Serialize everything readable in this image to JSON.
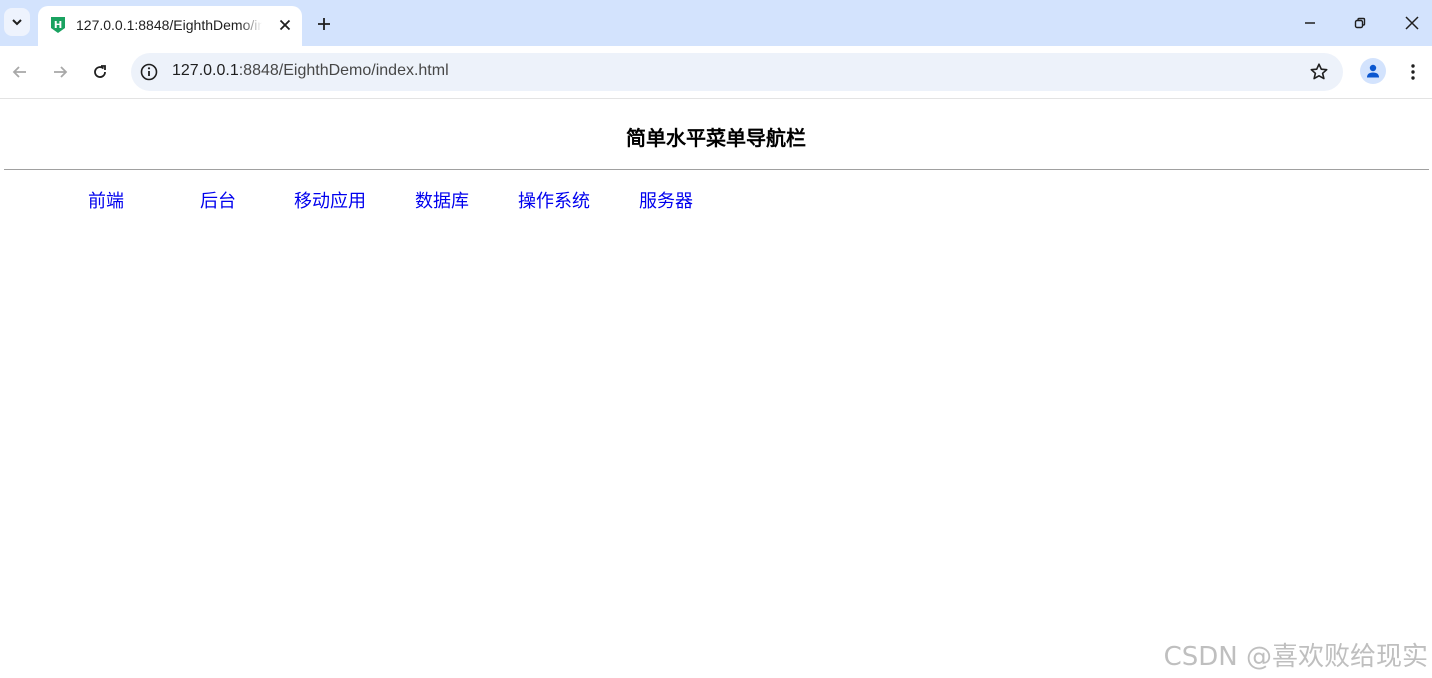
{
  "browser": {
    "tab": {
      "title": "127.0.0.1:8848/EighthDemo/index.html"
    },
    "address": {
      "host": "127.0.0.1",
      "rest": ":8848/EighthDemo/index.html"
    }
  },
  "page": {
    "title": "简单水平菜单导航栏",
    "menu": [
      {
        "label": "前端"
      },
      {
        "label": "后台"
      },
      {
        "label": "移动应用"
      },
      {
        "label": "数据库"
      },
      {
        "label": "操作系统"
      },
      {
        "label": "服务器"
      }
    ],
    "link_color": "#0000ee"
  },
  "watermark": "CSDN @喜欢败给现实",
  "colors": {
    "tabstrip": "#d3e3fd",
    "omnibox": "#edf2fa",
    "favicon": "#1aa260"
  }
}
